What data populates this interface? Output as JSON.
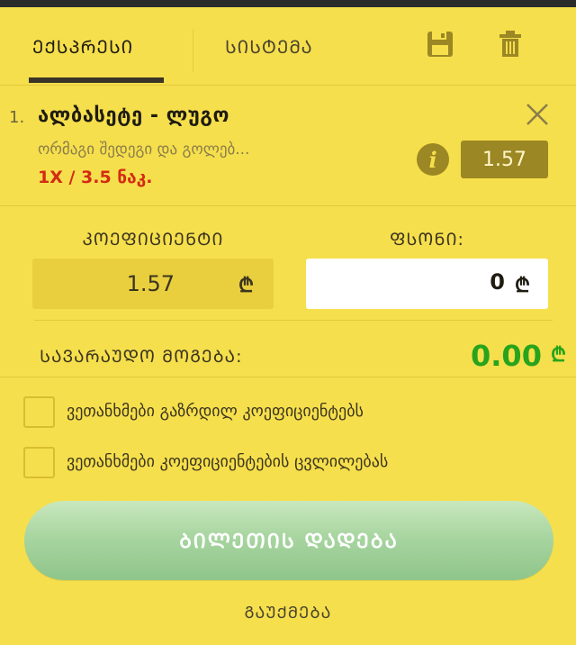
{
  "tabs": {
    "express": "ᲔᲥᲡᲞᲠᲔᲡᲘ",
    "system": "ᲡᲘᲡᲢᲔᲛᲐ"
  },
  "bet": {
    "number": "1.",
    "title": "ალბასეტე - ლუგო",
    "market": "ორმაგი შედეგი და გოლებ...",
    "pick": "1X / 3.5 ნაკ.",
    "odd": "1.57"
  },
  "coefficient": {
    "label": "ᲙᲝᲔᲤᲘᲪᲘᲔᲜᲢᲘ",
    "value": "1.57",
    "currency": "₾"
  },
  "stake": {
    "label": "ᲤᲡᲝᲜᲘ:",
    "value": "0",
    "currency": "₾"
  },
  "winnings": {
    "label": "ᲡᲐᲕᲐᲠᲐᲣᲓᲝ ᲛᲝᲒᲔᲑᲐ:",
    "value": "0.00",
    "currency": "₾"
  },
  "options": [
    {
      "label": "ვეთანხმები გაზრდილ კოეფიციენტებს",
      "checked": false
    },
    {
      "label": "ვეთანხმები კოეფიციენტების ცვლილებას",
      "checked": false
    }
  ],
  "actions": {
    "place_bet": "ᲑᲘᲚᲔᲗᲘᲡ ᲓᲐᲓᲔᲑᲐ",
    "cancel": "ᲒᲐᲣᲥᲛᲔᲑᲐ"
  },
  "icons": {
    "save": "save-icon",
    "trash": "trash-icon",
    "close": "close-icon",
    "info": "info-icon"
  },
  "colors": {
    "background": "#f6df4c",
    "odd_badge": "#9b8723",
    "pick_red": "#d32b14",
    "winnings_green": "#28a31c",
    "button_green": "#a8d5a0"
  }
}
